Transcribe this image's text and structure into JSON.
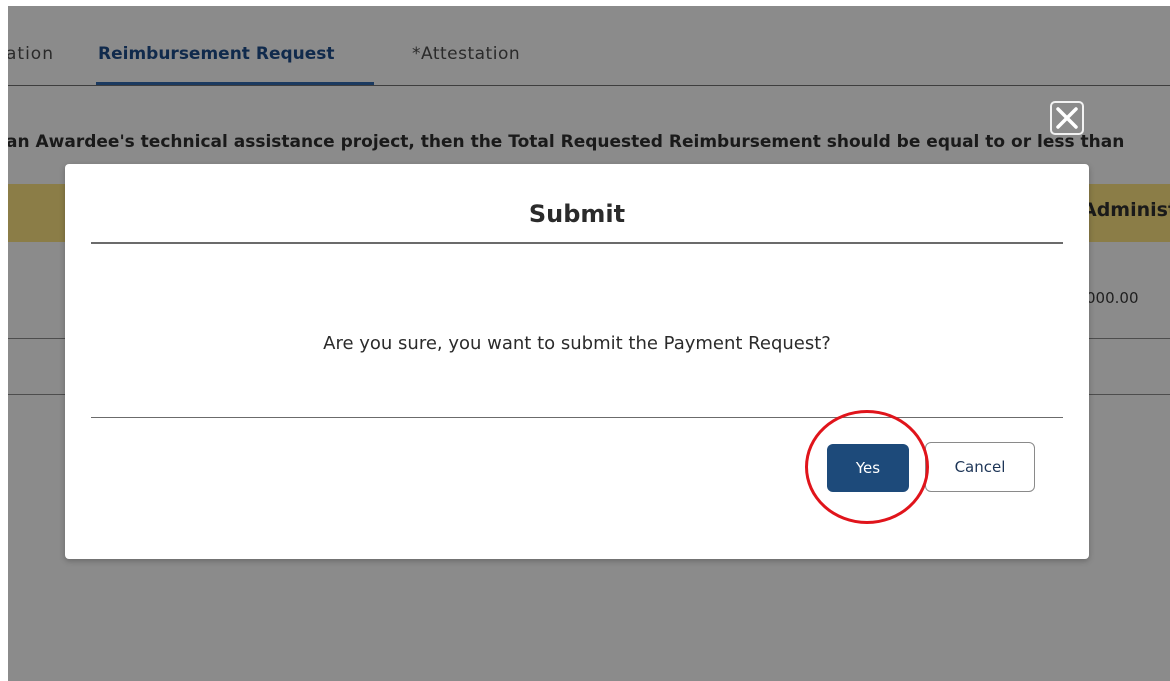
{
  "tabs": {
    "partial_label": "ation",
    "active_label": "Reimbursement Request",
    "attestation_label": "*Attestation"
  },
  "notice_text": "an Awardee's technical assistance project, then the Total Requested Reimbursement should be equal to or less than",
  "table": {
    "header_partial": "Administ",
    "cell_partial": "000.00"
  },
  "modal": {
    "title": "Submit",
    "message": "Are you sure, you want to submit the Payment Request?",
    "yes_label": "Yes",
    "cancel_label": "Cancel"
  },
  "colors": {
    "overlay": "#8b8b8b",
    "primary_button": "#1d4a7a",
    "table_header": "#8b7d47",
    "annotation": "#e0141b"
  }
}
